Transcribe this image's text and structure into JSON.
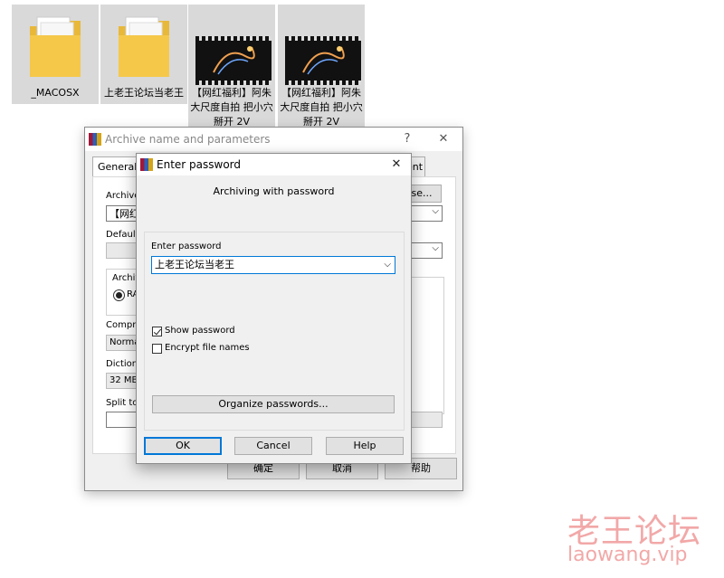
{
  "desktop": {
    "files": [
      {
        "name": "_MACOSX",
        "type": "folder"
      },
      {
        "name": "上老王论坛当老王",
        "type": "folder"
      },
      {
        "name": "【网红福利】阿朱大尺度自拍 把小穴掰开 2V",
        "type": "video"
      },
      {
        "name": "【网红福利】阿朱大尺度自拍 把小穴掰开 2V",
        "type": "video"
      }
    ]
  },
  "back_dialog": {
    "title": "Archive name and parameters",
    "help_glyph": "?",
    "close_glyph": "✕",
    "tab_general": "General",
    "tab_comment_fragment": "ent",
    "archive_label_fragment": "Archive",
    "archive_value_fragment": "【网红",
    "browse_fragment": "se...",
    "default_label_fragment": "Default",
    "archive_format_fragment": "Archiv",
    "rar_fragment": "RA",
    "compression_label_fragment": "Compre",
    "compression_value_fragment": "Normal",
    "dictionary_label_fragment": "Dictiona",
    "dictionary_value": "32 MB",
    "split_label_fragment": "Split to",
    "ok_cn": "确定",
    "cancel_cn": "取消",
    "help_cn": "帮助"
  },
  "password_dialog": {
    "title": "Enter password",
    "close_glyph": "✕",
    "subtitle": "Archiving with password",
    "enter_password_label": "Enter password",
    "password_value": "上老王论坛当老王",
    "show_password_label": "Show password",
    "show_password_checked": true,
    "encrypt_names_label": "Encrypt file names",
    "encrypt_names_checked": false,
    "organize_label": "Organize passwords...",
    "ok_label": "OK",
    "cancel_label": "Cancel",
    "help_label": "Help"
  },
  "watermark": {
    "line1": "老王论坛",
    "line2": "laowang.vip"
  },
  "colors": {
    "selection": "#cce4f7",
    "folder": "#f5c84a",
    "accent_focus": "#0078d7",
    "watermark": "#f2a8a8"
  }
}
